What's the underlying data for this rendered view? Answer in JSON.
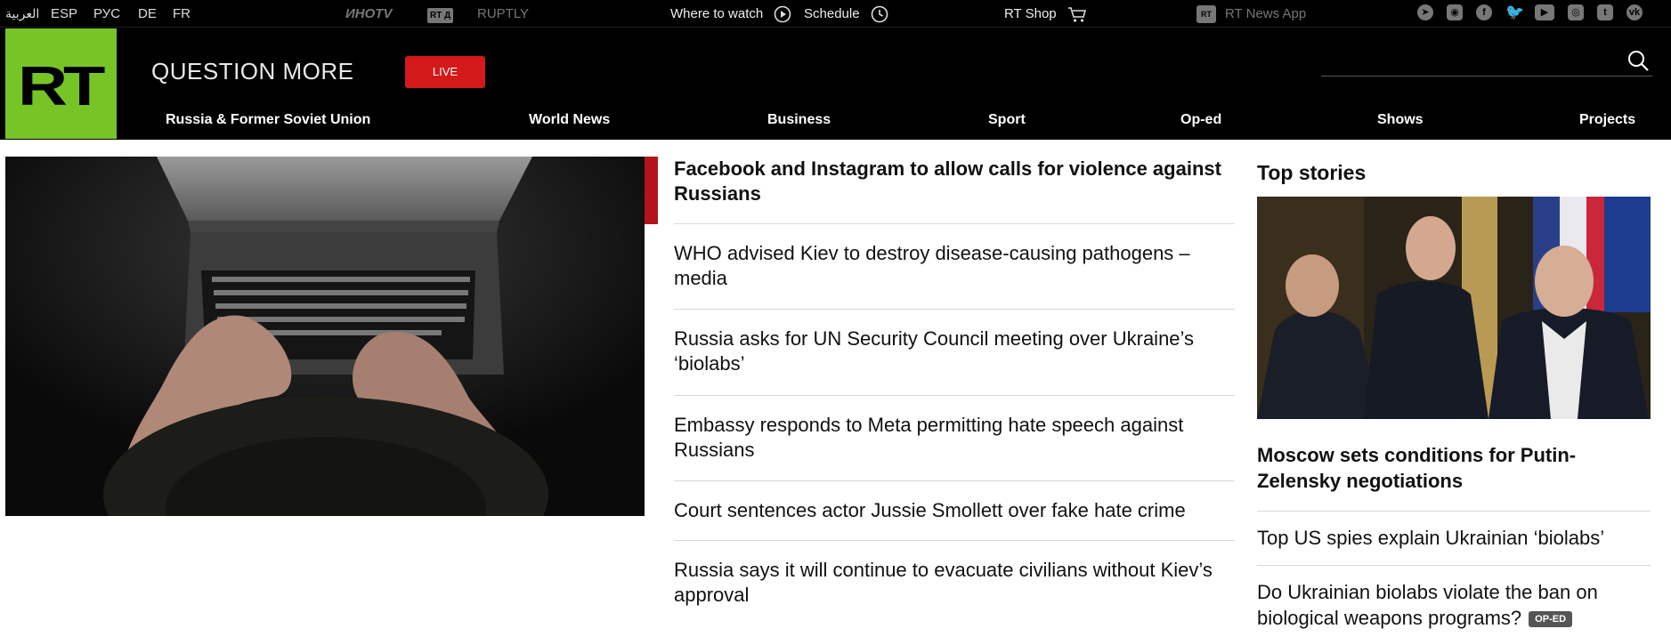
{
  "topbar": {
    "languages": [
      "العربية",
      "ESP",
      "РУС",
      "DE",
      "FR"
    ],
    "partners": {
      "inotv": "ИНОTV",
      "rtd": "RT Д",
      "ruptly": "RUPTLY"
    },
    "where_to_watch": "Where to watch",
    "schedule": "Schedule",
    "shop": "RT Shop",
    "app": "RT News App",
    "social_icons": [
      "telegram-icon",
      "rss-icon",
      "facebook-icon",
      "twitter-icon",
      "youtube-icon",
      "instagram-icon",
      "tumblr-icon",
      "vk-icon"
    ]
  },
  "header": {
    "logo": "RT",
    "slogan": "QUESTION MORE",
    "live_label": "LIVE",
    "brand_color": "#77c426",
    "live_color": "#d3191a"
  },
  "nav": {
    "items": [
      "Russia & Former Soviet Union",
      "World News",
      "Business",
      "Sport",
      "Op-ed",
      "Shows",
      "Projects"
    ]
  },
  "main": {
    "headlines": [
      "Facebook and Instagram to allow calls for violence against Russians",
      "WHO advised Kiev to destroy disease-causing pathogens – media",
      "Russia asks for UN Security Council meeting over Ukraine’s ‘biolabs’",
      "Embassy responds to Meta permitting hate speech against Russians",
      "Court sentences actor Jussie Smollett over fake hate crime",
      "Russia says it will continue to evacuate civilians without Kiev’s approval"
    ],
    "accent_color": "#b3141a"
  },
  "top_stories": {
    "title": "Top stories",
    "lead": "Moscow sets conditions for Putin-Zelensky negotiations",
    "items": [
      "Top US spies explain Ukrainian ‘biolabs’",
      "Do Ukrainian biolabs violate the ban on biological weapons programs?"
    ],
    "badge": "OP-ED"
  }
}
